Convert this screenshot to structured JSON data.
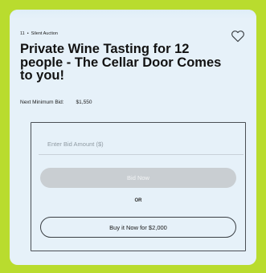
{
  "auction": {
    "lot_number": "11",
    "separator": "•",
    "type": "Silent Auction",
    "title": "Private Wine Tasting for 12 people - The Cellar Door Comes to you!",
    "min_bid_label": "Next Minimum Bid:",
    "min_bid_value": "$1,550"
  },
  "bid_form": {
    "input_placeholder": "Enter Bid Amount ($)",
    "bid_button": "Bid Now",
    "or_label": "OR",
    "buy_now_button": "Buy it Now for $2,000"
  },
  "icons": {
    "favorite": "heart-outline-icon"
  },
  "colors": {
    "page_background": "#b9dc2e",
    "card_background": "#e6f1f9",
    "disabled_button": "#c9ced2"
  }
}
